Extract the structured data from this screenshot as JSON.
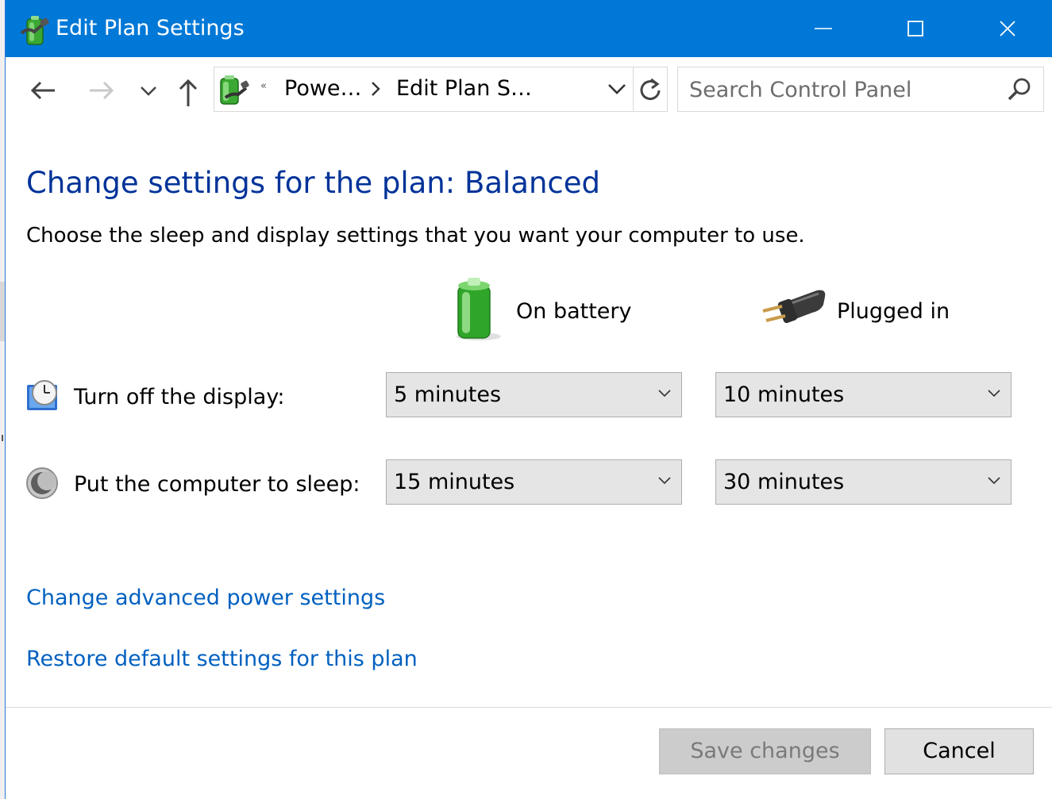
{
  "window": {
    "title": "Edit Plan Settings",
    "accent": "#0078d7"
  },
  "address": {
    "crumbs": [
      "Powe…",
      "Edit Plan S…"
    ],
    "overflow_glyph": "«"
  },
  "search": {
    "placeholder": "Search Control Panel"
  },
  "main": {
    "heading": "Change settings for the plan: Balanced",
    "subtitle": "Choose the sleep and display settings that you want your computer to use.",
    "columns": {
      "battery": "On battery",
      "plugged": "Plugged in"
    },
    "rows": [
      {
        "label": "Turn off the display:",
        "battery": "5 minutes",
        "plugged": "10 minutes",
        "icon": "display-clock-icon"
      },
      {
        "label": "Put the computer to sleep:",
        "battery": "15 minutes",
        "plugged": "30 minutes",
        "icon": "sleep-moon-icon"
      }
    ],
    "links": {
      "advanced": "Change advanced power settings",
      "restore": "Restore default settings for this plan"
    }
  },
  "footer": {
    "save": "Save changes",
    "cancel": "Cancel"
  }
}
